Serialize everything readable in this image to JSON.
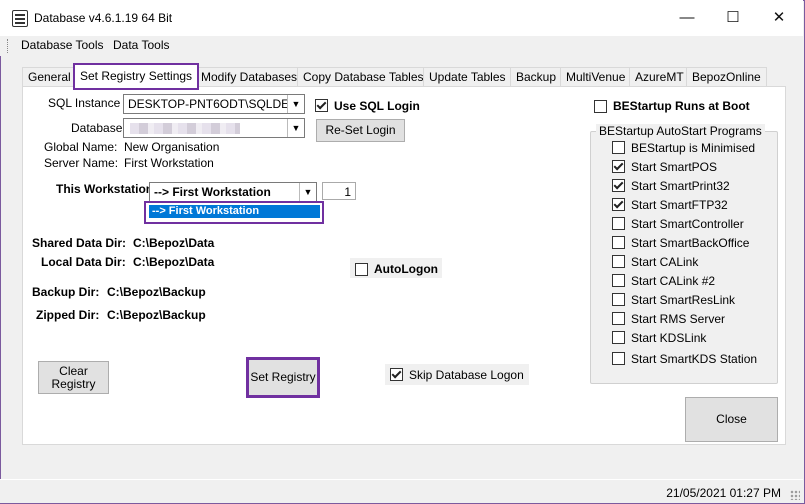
{
  "window": {
    "title": "Database v4.6.1.19 64 Bit",
    "minimize_glyph": "—",
    "maximize_glyph": "☐",
    "close_glyph": "✕"
  },
  "menu": {
    "items": [
      "Database Tools",
      "Data Tools"
    ]
  },
  "tabs": [
    {
      "label": "General"
    },
    {
      "label": "Set Registry Settings",
      "active": true
    },
    {
      "label": "Modify Databases"
    },
    {
      "label": "Copy Database Tables"
    },
    {
      "label": "Update Tables"
    },
    {
      "label": "Backup"
    },
    {
      "label": "MultiVenue"
    },
    {
      "label": "AzureMT"
    },
    {
      "label": "BepozOnline"
    }
  ],
  "form": {
    "sql_instance_label": "SQL Instance :",
    "sql_instance_value": "DESKTOP-PNT6ODT\\SQLDE",
    "database_label": "Database:",
    "database_value": "",
    "global_name_label": "Global Name:",
    "global_name_value": "New Organisation",
    "server_name_label": "Server Name:",
    "server_name_value": "First Workstation",
    "this_workstation_label": "This Workstation:",
    "this_workstation_value": "--> First Workstation",
    "workstation_number": "1",
    "dropdown_option": "--> First Workstation",
    "use_sql_login_label": "Use SQL Login",
    "use_sql_login_checked": true,
    "reset_login_button": "Re-Set Login",
    "shared_dir_label": "Shared Data Dir:",
    "shared_dir_value": "C:\\Bepoz\\Data",
    "local_dir_label": "Local Data Dir:",
    "local_dir_value": "C:\\Bepoz\\Data",
    "autologon_label": "AutoLogon",
    "autologon_checked": false,
    "backup_dir_label": "Backup Dir:",
    "backup_dir_value": "C:\\Bepoz\\Backup",
    "zipped_dir_label": "Zipped Dir:",
    "zipped_dir_value": "C:\\Bepoz\\Backup",
    "clear_registry_button": "Clear Registry",
    "set_registry_button": "Set Registry",
    "skip_db_logon_label": "Skip Database Logon",
    "skip_db_logon_checked": true
  },
  "startup": {
    "runs_at_boot_label": "BEStartup Runs at Boot",
    "runs_at_boot_checked": false,
    "group_title": "BEStartup AutoStart Programs",
    "programs": [
      {
        "label": "BEStartup is Minimised",
        "checked": false
      },
      {
        "label": "Start SmartPOS",
        "checked": true
      },
      {
        "label": "Start SmartPrint32",
        "checked": true
      },
      {
        "label": "Start SmartFTP32",
        "checked": true
      },
      {
        "label": "Start SmartController",
        "checked": false
      },
      {
        "label": "Start SmartBackOffice",
        "checked": false
      },
      {
        "label": "Start CALink",
        "checked": false
      },
      {
        "label": "Start CALink #2",
        "checked": false
      },
      {
        "label": "Start SmartResLink",
        "checked": false
      },
      {
        "label": "Start RMS Server",
        "checked": false
      },
      {
        "label": "Start KDSLink",
        "checked": false
      },
      {
        "label": "Start SmartKDS Station",
        "checked": false
      }
    ]
  },
  "close_button": "Close",
  "status": {
    "datetime": "21/05/2021 01:27 PM"
  },
  "colors": {
    "highlight_border": "#7030a0",
    "selection_blue": "#0078d7"
  }
}
